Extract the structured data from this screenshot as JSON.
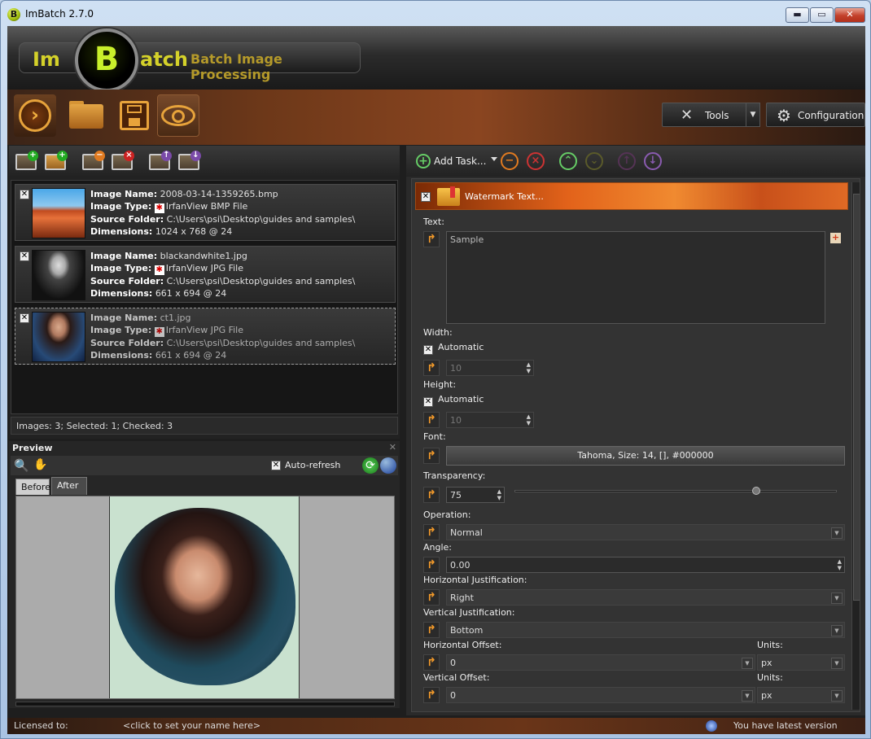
{
  "window": {
    "title": "ImBatch 2.7.0",
    "app_icon_letter": "B",
    "min_symbol": "▬",
    "max_symbol": "▭",
    "close_symbol": "✕"
  },
  "logo": {
    "im": "Im",
    "b": "B",
    "atch": "atch",
    "subtitle": "Batch Image Processing"
  },
  "main_toolbar": {
    "run_symbol": "›",
    "tools_label": "Tools",
    "tools_icon": "wrench-screwdriver-icon",
    "config_label": "Configuration",
    "config_icon": "gear-icon",
    "dropdown_symbol": "▼"
  },
  "files": [
    {
      "name": "2008-03-14-1359265.bmp",
      "type": "IrfanView BMP File",
      "folder": "C:\\Users\\psi\\Desktop\\guides and samples\\",
      "dimensions": "1024 x 768 @ 24",
      "checked": true,
      "selected": false
    },
    {
      "name": "blackandwhite1.jpg",
      "type": "IrfanView JPG File",
      "folder": "C:\\Users\\psi\\Desktop\\guides and samples\\",
      "dimensions": "661 x 694 @ 24",
      "checked": true,
      "selected": false
    },
    {
      "name": "ct1.jpg",
      "type": "IrfanView JPG File",
      "folder": "C:\\Users\\psi\\Desktop\\guides and samples\\",
      "dimensions": "661 x 694 @ 24",
      "checked": true,
      "selected": true
    }
  ],
  "file_labels": {
    "name": "Image Name:",
    "type": "Image Type:",
    "folder": "Source Folder:",
    "dimensions": "Dimensions:"
  },
  "left_status": "Images: 3; Selected: 1; Checked: 3",
  "preview": {
    "title": "Preview",
    "close": "✕",
    "auto_refresh_label": "Auto-refresh",
    "auto_refresh": true,
    "tab_before": "Before",
    "tab_after": "After",
    "active_tab": "After"
  },
  "task_toolbar": {
    "add_task_label": "Add Task..."
  },
  "task": {
    "title": "Watermark Text...",
    "text_label": "Text:",
    "text_value": "Sample",
    "width_label": "Width:",
    "width_auto_label": "Automatic",
    "width_auto": true,
    "width_value": "10",
    "height_label": "Height:",
    "height_auto_label": "Automatic",
    "height_auto": true,
    "height_value": "10",
    "font_label": "Font:",
    "font_value": "Tahoma, Size: 14, [], #000000",
    "transparency_label": "Transparency:",
    "transparency_value": "75",
    "transparency_max": 100,
    "operation_label": "Operation:",
    "operation_value": "Normal",
    "angle_label": "Angle:",
    "angle_value": "0.00",
    "hjust_label": "Horizontal Justification:",
    "hjust_value": "Right",
    "vjust_label": "Vertical Justification:",
    "vjust_value": "Bottom",
    "hoffset_label": "Horizontal Offset:",
    "hoffset_value": "0",
    "hunits_label": "Units:",
    "hunits_value": "px",
    "voffset_label": "Vertical Offset:",
    "voffset_value": "0",
    "vunits_label": "Units:",
    "vunits_value": "px"
  },
  "status": {
    "licensed_label": "Licensed to:",
    "licensed_name": "<click to set your name here>",
    "update_text": "You have latest version"
  },
  "colors": {
    "accent_orange": "#e2621a",
    "logo_yellow": "#d4d12a"
  }
}
